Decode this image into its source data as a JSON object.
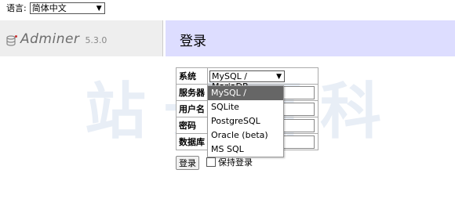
{
  "language": {
    "label": "语言:",
    "selected": "简体中文"
  },
  "app": {
    "name": "Adminer",
    "version": "5.3.0"
  },
  "page": {
    "title": "登录"
  },
  "watermark": "站长百科",
  "form": {
    "labels": {
      "system": "系统",
      "server": "服务器",
      "username": "用户名",
      "password": "密码",
      "database": "数据库"
    },
    "system_selected": "MySQL / MariaDB",
    "system_options": [
      "MySQL / MariaDB",
      "SQLite",
      "PostgreSQL",
      "Oracle (beta)",
      "MS SQL"
    ],
    "login_button": "登录",
    "remember_label": "保持登录"
  },
  "colors": {
    "header_bg": "#ddddff",
    "menu_bg": "#eeeeee",
    "selected_option_bg": "#666666"
  },
  "icons": {
    "logo": "database-icon",
    "caret": "chevron-down-icon"
  }
}
